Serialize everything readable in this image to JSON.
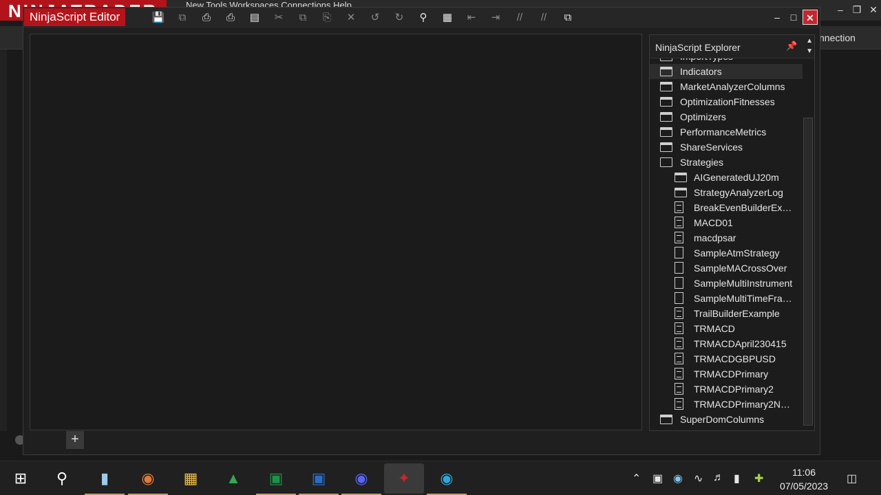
{
  "background_app": {
    "logo_text": "NINJATRADER",
    "menu_text": "New  Tools  Workspaces  Connections  Help",
    "connection_label": "nnection"
  },
  "editor": {
    "title": "NinjaScript Editor",
    "toolbar": [
      {
        "icon": "save-icon"
      },
      {
        "icon": "save-all-icon"
      },
      {
        "icon": "print-icon"
      },
      {
        "icon": "print-preview-icon"
      },
      {
        "icon": "page-setup-icon"
      },
      {
        "icon": "cut-icon"
      },
      {
        "icon": "copy-icon"
      },
      {
        "icon": "paste-icon"
      },
      {
        "icon": "delete-icon"
      },
      {
        "icon": "undo-icon"
      },
      {
        "icon": "redo-icon"
      },
      {
        "icon": "find-icon"
      },
      {
        "icon": "compile-icon"
      },
      {
        "icon": "outdent-icon"
      },
      {
        "icon": "indent-icon"
      },
      {
        "icon": "comment-icon"
      },
      {
        "icon": "uncomment-icon"
      },
      {
        "icon": "visual-studio-icon"
      }
    ],
    "add_tab_label": "+"
  },
  "explorer": {
    "title": "NinjaScript Explorer",
    "items": [
      {
        "label": "ImportTypes",
        "type": "folder",
        "level": 0
      },
      {
        "label": "Indicators",
        "type": "folder",
        "level": 0,
        "selected": true
      },
      {
        "label": "MarketAnalyzerColumns",
        "type": "folder",
        "level": 0
      },
      {
        "label": "OptimizationFitnesses",
        "type": "folder",
        "level": 0
      },
      {
        "label": "Optimizers",
        "type": "folder",
        "level": 0
      },
      {
        "label": "PerformanceMetrics",
        "type": "folder",
        "level": 0
      },
      {
        "label": "ShareServices",
        "type": "folder",
        "level": 0
      },
      {
        "label": "Strategies",
        "type": "folder-open",
        "level": 0
      },
      {
        "label": "AIGeneratedUJ20m",
        "type": "folder",
        "level": 1
      },
      {
        "label": "StrategyAnalyzerLog",
        "type": "folder",
        "level": 1
      },
      {
        "label": "BreakEvenBuilderEx…",
        "type": "file",
        "level": 1
      },
      {
        "label": "MACD01",
        "type": "file",
        "level": 1
      },
      {
        "label": "macdpsar",
        "type": "file",
        "level": 1
      },
      {
        "label": "SampleAtmStrategy",
        "type": "file-locked",
        "level": 1
      },
      {
        "label": "SampleMACrossOver",
        "type": "file-locked",
        "level": 1
      },
      {
        "label": "SampleMultiInstrument",
        "type": "file-locked",
        "level": 1
      },
      {
        "label": "SampleMultiTimeFra…",
        "type": "file-locked",
        "level": 1
      },
      {
        "label": "TrailBuilderExample",
        "type": "file",
        "level": 1
      },
      {
        "label": "TRMACD",
        "type": "file",
        "level": 1
      },
      {
        "label": "TRMACDApril230415",
        "type": "file",
        "level": 1
      },
      {
        "label": "TRMACDGBPUSD",
        "type": "file",
        "level": 1
      },
      {
        "label": "TRMACDPrimary",
        "type": "file",
        "level": 1
      },
      {
        "label": "TRMACDPrimary2",
        "type": "file",
        "level": 1
      },
      {
        "label": "TRMACDPrimary2N…",
        "type": "file",
        "level": 1
      },
      {
        "label": "SuperDomColumns",
        "type": "folder",
        "level": 0
      }
    ]
  },
  "taskbar": {
    "apps": [
      {
        "icon": "windows-start-icon"
      },
      {
        "icon": "search-icon"
      },
      {
        "icon": "notepad-icon"
      },
      {
        "icon": "faststone-icon"
      },
      {
        "icon": "file-explorer-icon"
      },
      {
        "icon": "google-drive-icon"
      },
      {
        "icon": "excel-icon"
      },
      {
        "icon": "word-icon"
      },
      {
        "icon": "discord-icon"
      },
      {
        "icon": "ninjatrader-icon"
      },
      {
        "icon": "edge-icon"
      }
    ],
    "time": "11:06",
    "date": "07/05/2023"
  },
  "colors": {
    "accent": "#b3141b",
    "background": "#1b1b1b"
  }
}
